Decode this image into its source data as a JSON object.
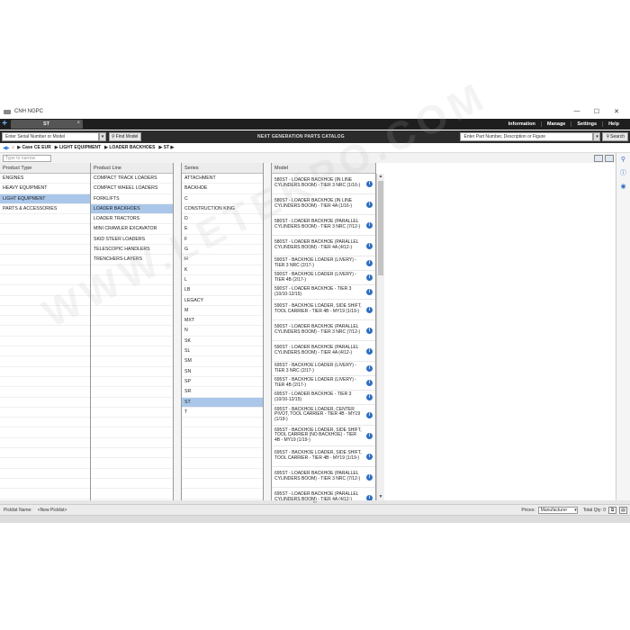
{
  "window": {
    "title": "CNH NGPC",
    "minimize": "—",
    "maximize": "☐",
    "close": "✕"
  },
  "tabbar": {
    "new_tab": "+",
    "tab_label": "ST",
    "tab_close": "×",
    "menu": [
      "Information",
      "Manage",
      "Settings",
      "Help"
    ]
  },
  "searchbar": {
    "serial_placeholder": "Enter Serial Number or Model",
    "find_model": "Find Model",
    "center_title": "NEXT GENERATION PARTS CATALOG",
    "part_placeholder": "Enter Part Number, Description or Figure",
    "search": "Search"
  },
  "breadcrumb": [
    "Case CE EUR",
    "LIGHT EQUIPMENT",
    "LOADER BACKHOES",
    "ST"
  ],
  "filter": {
    "placeholder": "Type to narrow"
  },
  "columns": {
    "product_type": {
      "header": "Product Type",
      "items": [
        "ENGINES",
        "HEAVY EQUIPMENT",
        "LIGHT EQUIPMENT",
        "PARTS & ACCESSORIES"
      ],
      "selected": 2
    },
    "product_line": {
      "header": "Product Line",
      "items": [
        "COMPACT TRACK LOADERS",
        "COMPACT WHEEL LOADERS",
        "FORKLIFTS",
        "LOADER BACKHOES",
        "LOADER TRACTORS",
        "MINI CRAWLER EXCAVATOR",
        "SKID STEER LOADERS",
        "TELESCOPIC HANDLERS",
        "TRENCHERS-LAYERS"
      ],
      "selected": 3
    },
    "series": {
      "header": "Series",
      "items": [
        "ATTACHMENT",
        "BACKHOE",
        "C",
        "CONSTRUCTION KING",
        "D",
        "E",
        "F",
        "G",
        "H",
        "K",
        "L",
        "LB",
        "LEGACY",
        "M",
        "MXT",
        "N",
        "SK",
        "SL",
        "SM",
        "SN",
        "SP",
        "SR",
        "ST",
        "T"
      ],
      "selected": 22
    },
    "model": {
      "header": "Model",
      "items": [
        "580ST - LOADER BACKHOE (IN LINE CYLINDERS BOOM) - TIER 3 NRC (1/16-)",
        "580ST - LOADER BACKHOE (IN LINE CYLINDERS BOOM) - TIER 4A (1/16-)",
        "580ST - LOADER BACKHOE (PARALLEL CYLINDERS BOOM) - TIER 3 NRC (7/12-)",
        "580ST - LOADER BACKHOE (PARALLEL CYLINDERS BOOM) - TIER 4A (4/12-)",
        "590ST - BACKHOE LOADER (LIVERY) - TIER 3 NRC (2/17-)",
        "590ST - BACKHOE LOADER (LIVERY) - TIER 4B (2/17-)",
        "590ST - LOADER BACKHOE - TIER 3 (10/10-12/15)",
        "590ST - BACKHOE LOADER, SIDE SHIFT, TOOL CARRIER - TIER 4B - MY19 (1/19-)",
        "590ST - LOADER BACKHOE (PARALLEL CYLINDERS BOOM) - TIER 3 NRC (7/12-)",
        "590ST - LOADER BACKHOE (PARALLEL CYLINDERS BOOM) - TIER 4A (4/12-)",
        "695ST - BACKHOE LOADER (LIVERY) - TIER 3 NRC (2/17-)",
        "695ST - BACKHOE LOADER (LIVERY) - TIER 4B (2/17-)",
        "695ST - LOADER BACKHOE - TIER 3 (10/10-12/15)",
        "695ST - BACKHOE LOADER, CENTER PIVOT, TOOL CARRIER - TIER 4B - MY19 (1/19-)",
        "695ST - BACKHOE LOADER, SIDE SHIFT, TOOL CARRIER (NO BACKHOE) - TIER 4B - MY19 (1/19-)",
        "695ST - BACKHOE LOADER, SIDE SHIFT, TOOL CARRIER - TIER 4B - MY19 (1/19-)",
        "695ST - LOADER BACKHOE (PARALLEL CYLINDERS BOOM) - TIER 3 NRC (7/12-)",
        "695ST - LOADER BACKHOE (PARALLEL CYLINDERS BOOM) - TIER 4A (4/12-)"
      ]
    }
  },
  "statusbar": {
    "picklist_label": "Picklist Name:",
    "picklist_value": "<New Picklist>",
    "prices_label": "Prices:",
    "prices_value": "Manufacturer",
    "total_qty": "Total Qty: 0"
  },
  "watermark": "WWW.LETEKPO.COM",
  "colors": {
    "selection": "#aac7ea",
    "header_dark": "#1e1e1e",
    "info_icon": "#2f6fc2"
  }
}
